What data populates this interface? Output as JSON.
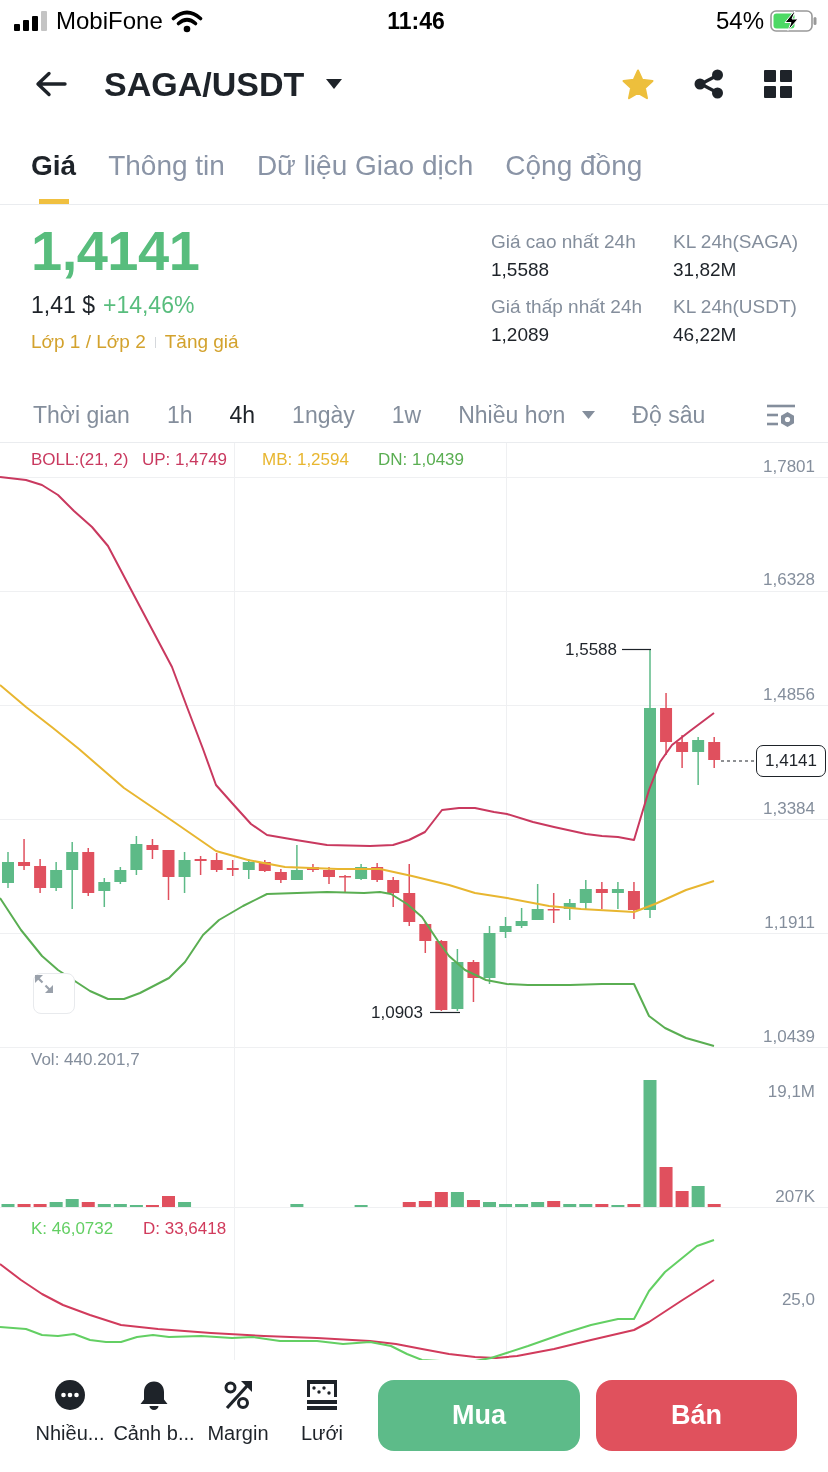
{
  "status_bar": {
    "carrier": "MobiFone",
    "time": "11:46",
    "battery": "54%"
  },
  "header": {
    "pair": "SAGA/USDT",
    "favorite": true
  },
  "tabs": [
    {
      "label": "Giá",
      "selected": true
    },
    {
      "label": "Thông tin",
      "selected": false
    },
    {
      "label": "Dữ liệu Giao dịch",
      "selected": false
    },
    {
      "label": "Cộng đồng",
      "selected": false
    }
  ],
  "price": {
    "last": "1,4141",
    "fiat": "1,41 $",
    "change": "+14,46%",
    "tags": [
      "Lớp 1 / Lớp 2",
      "Tăng giá"
    ]
  },
  "stats": [
    {
      "label": "Giá cao nhất 24h",
      "value": "1,5588"
    },
    {
      "label": "KL 24h(SAGA)",
      "value": "31,82M"
    },
    {
      "label": "Giá thấp nhất 24h",
      "value": "1,2089"
    },
    {
      "label": "KL 24h(USDT)",
      "value": "46,22M"
    }
  ],
  "intervals": [
    {
      "label": "Thời gian",
      "kind": "option",
      "selected": false
    },
    {
      "label": "1h",
      "kind": "option",
      "selected": false
    },
    {
      "label": "4h",
      "kind": "option",
      "selected": true
    },
    {
      "label": "1ngày",
      "kind": "option",
      "selected": false
    },
    {
      "label": "1w",
      "kind": "option",
      "selected": false
    },
    {
      "label": "Nhiều hơn",
      "kind": "dropdown",
      "selected": false
    },
    {
      "label": "Độ sâu",
      "kind": "option",
      "selected": false
    }
  ],
  "chart": {
    "legend": [
      {
        "text": "BOLL:(21, 2)",
        "color": "#c9395f"
      },
      {
        "text": "UP: 1,4749",
        "color": "#c9395f"
      },
      {
        "text": "MB: 1,2594",
        "color": "#e8b630"
      },
      {
        "text": "DN: 1,0439",
        "color": "#5aae52"
      }
    ],
    "price_axis": [
      "1,7801",
      "1,6328",
      "1,4856",
      "1,3384",
      "1,1911",
      "1,0439"
    ],
    "high_label": "1,5588",
    "low_label": "1,0903",
    "current_price": "1,4141",
    "volume": {
      "label": "Vol: 440.201,7",
      "axis": [
        "19,1M",
        "207K"
      ]
    },
    "kdj": {
      "legend": [
        {
          "text": "K: 46,0732",
          "color": "#63cf63"
        },
        {
          "text": "D: 33,6418",
          "color": "#d13b5c"
        }
      ],
      "axis": [
        "25,0"
      ]
    }
  },
  "toolbar": [
    {
      "kind": "more",
      "label": "Nhiều..."
    },
    {
      "kind": "alert",
      "label": "Cảnh b..."
    },
    {
      "kind": "margin",
      "label": "Margin"
    },
    {
      "kind": "grid",
      "label": "Lưới"
    }
  ],
  "actions": [
    {
      "kind": "buy",
      "label": "Mua"
    },
    {
      "kind": "sell",
      "label": "Bán"
    }
  ]
}
